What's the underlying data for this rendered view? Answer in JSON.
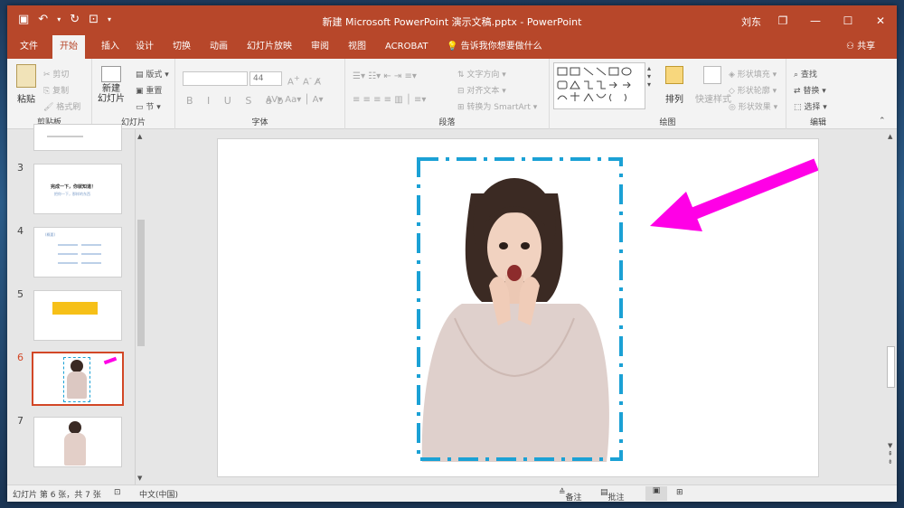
{
  "titlebar": {
    "title": "新建 Microsoft PowerPoint 演示文稿.pptx  -  PowerPoint",
    "user": "刘东",
    "minimize": "—",
    "restore": "❐",
    "maximize": "☐",
    "close": "✕"
  },
  "tabs": [
    "文件",
    "开始",
    "插入",
    "设计",
    "切换",
    "动画",
    "幻灯片放映",
    "审阅",
    "视图",
    "ACROBAT",
    "告诉我你想要做什么"
  ],
  "share": "共享",
  "ribbon": {
    "clipboard": {
      "paste": "粘贴",
      "cut": "剪切",
      "copy": "复制",
      "format_painter": "格式刷",
      "label": "剪贴板"
    },
    "slides": {
      "new_slide": "新建",
      "new_slide2": "幻灯片",
      "layout": "版式",
      "reset": "重置",
      "section": "节",
      "label": "幻灯片"
    },
    "font": {
      "size": "44",
      "label": "字体"
    },
    "paragraph": {
      "text_direction": "文字方向",
      "align_text": "对齐文本",
      "smartart": "转换为 SmartArt",
      "label": "段落"
    },
    "drawing": {
      "arrange": "排列",
      "quick_styles": "快速样式",
      "shape_fill": "形状填充",
      "shape_outline": "形状轮廓",
      "shape_effects": "形状效果",
      "label": "绘图"
    },
    "editing": {
      "find": "查找",
      "replace": "替换",
      "select": "选择",
      "label": "编辑"
    }
  },
  "thumbnails": [
    {
      "num": "3",
      "line1": "完成一下，你就知道！",
      "line2": "把你一下，那样的东西"
    },
    {
      "num": "4",
      "line1": "(概要)"
    },
    {
      "num": "5"
    },
    {
      "num": "6"
    },
    {
      "num": "7"
    }
  ],
  "status": {
    "slide_info": "幻灯片 第 6 张，共 7 张",
    "language": "中文(中国)",
    "notes": "备注",
    "comments": "批注"
  },
  "colors": {
    "brand": "#b7472a",
    "dash_border": "#1ba1d5",
    "arrow": "#ff00e6"
  }
}
